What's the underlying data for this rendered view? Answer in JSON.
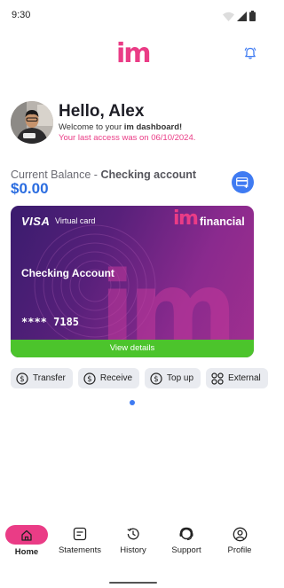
{
  "status_bar": {
    "time": "9:30"
  },
  "header": {
    "logo_text": "im"
  },
  "user": {
    "greeting": "Hello, Alex",
    "welcome_prefix": "Welcome to your ",
    "welcome_bold": "im dashboard!",
    "last_access": "Your last access was on 06/10/2024."
  },
  "balance": {
    "label_prefix": "Current Balance - ",
    "account_type": "Checking account",
    "amount": "$0.00"
  },
  "card": {
    "network": "VISA",
    "type": "Virtual card",
    "brand_im": "im",
    "brand_suffix": "financial",
    "account_name": "Checking Account",
    "number_masked": "**** 7185",
    "view_details_label": "View details"
  },
  "actions": [
    {
      "label": "Transfer",
      "icon": "dollar-circle-icon"
    },
    {
      "label": "Receive",
      "icon": "dollar-circle-icon"
    },
    {
      "label": "Top up",
      "icon": "dollar-circle-icon"
    },
    {
      "label": "External",
      "icon": "grid-circles-icon"
    }
  ],
  "pagination": {
    "active_index": 0,
    "count": 1
  },
  "bottom_nav": [
    {
      "label": "Home",
      "icon": "home-icon",
      "active": true
    },
    {
      "label": "Statements",
      "icon": "document-icon",
      "active": false
    },
    {
      "label": "History",
      "icon": "history-icon",
      "active": false
    },
    {
      "label": "Support",
      "icon": "support-icon",
      "active": false
    },
    {
      "label": "Profile",
      "icon": "profile-icon",
      "active": false
    }
  ],
  "colors": {
    "brand_pink": "#ea3c86",
    "accent_blue": "#2b6de0",
    "success_green": "#4cc42c"
  }
}
